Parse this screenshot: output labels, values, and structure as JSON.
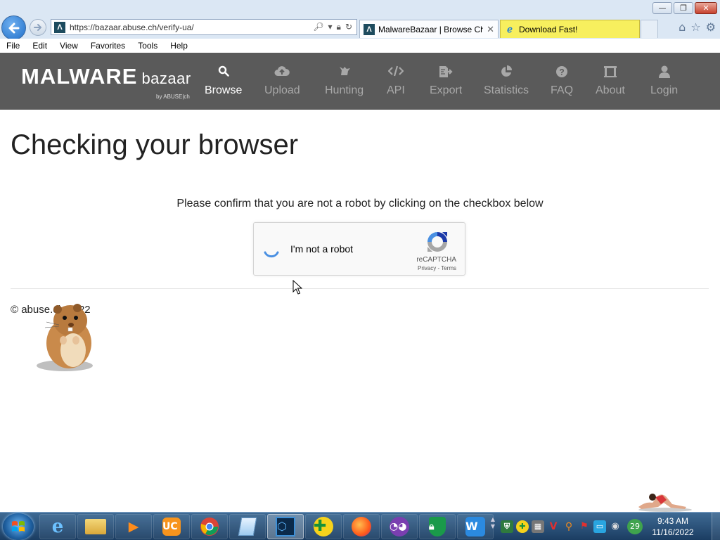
{
  "browser": {
    "url": "https://bazaar.abuse.ch/verify-ua/",
    "favicon_letter": "Λ",
    "tabs": [
      {
        "label": "MalwareBazaar | Browse Ch...",
        "close": "✕"
      },
      {
        "label": "Download Fast!"
      }
    ],
    "window_controls": {
      "minimize": "—",
      "maximize": "❐",
      "close": "✕"
    },
    "menu": [
      "File",
      "Edit",
      "View",
      "Favorites",
      "Tools",
      "Help"
    ]
  },
  "site": {
    "logo_main": "MALWARE",
    "logo_sub": "bazaar",
    "logo_by": "by ABUSE|ch",
    "nav": [
      {
        "label": "Browse",
        "icon": "search-icon",
        "active": true
      },
      {
        "label": "Upload",
        "icon": "cloud-upload-icon"
      },
      {
        "label": "Hunting",
        "icon": "hunting-icon"
      },
      {
        "label": "API",
        "icon": "code-icon"
      },
      {
        "label": "Export",
        "icon": "export-icon"
      },
      {
        "label": "Statistics",
        "icon": "pie-chart-icon"
      },
      {
        "label": "FAQ",
        "icon": "question-icon"
      },
      {
        "label": "About",
        "icon": "building-icon"
      },
      {
        "label": "Login",
        "icon": "user-icon"
      }
    ]
  },
  "main": {
    "title": "Checking your browser",
    "instruction": "Please confirm that you are not a robot by clicking on the checkbox below",
    "recaptcha": {
      "label": "I'm not a robot",
      "brand": "reCAPTCHA",
      "links": "Privacy - Terms"
    },
    "footer": "© abuse.ch 2022"
  },
  "taskbar": {
    "apps": [
      "internet-explorer",
      "file-explorer",
      "media-player",
      "uc-browser",
      "chrome",
      "notepad",
      "cube-app",
      "plus-app",
      "firefox",
      "mask-app",
      "shield-app",
      "wps-office"
    ],
    "tray_badge": "29",
    "time": "9:43 AM",
    "date": "11/16/2022"
  },
  "colors": {
    "nav_bg": "#5a5a5a",
    "nav_active": "#ffffff",
    "nav_inactive": "#a8a8a8",
    "tab_yellow": "#f7ef5e"
  }
}
